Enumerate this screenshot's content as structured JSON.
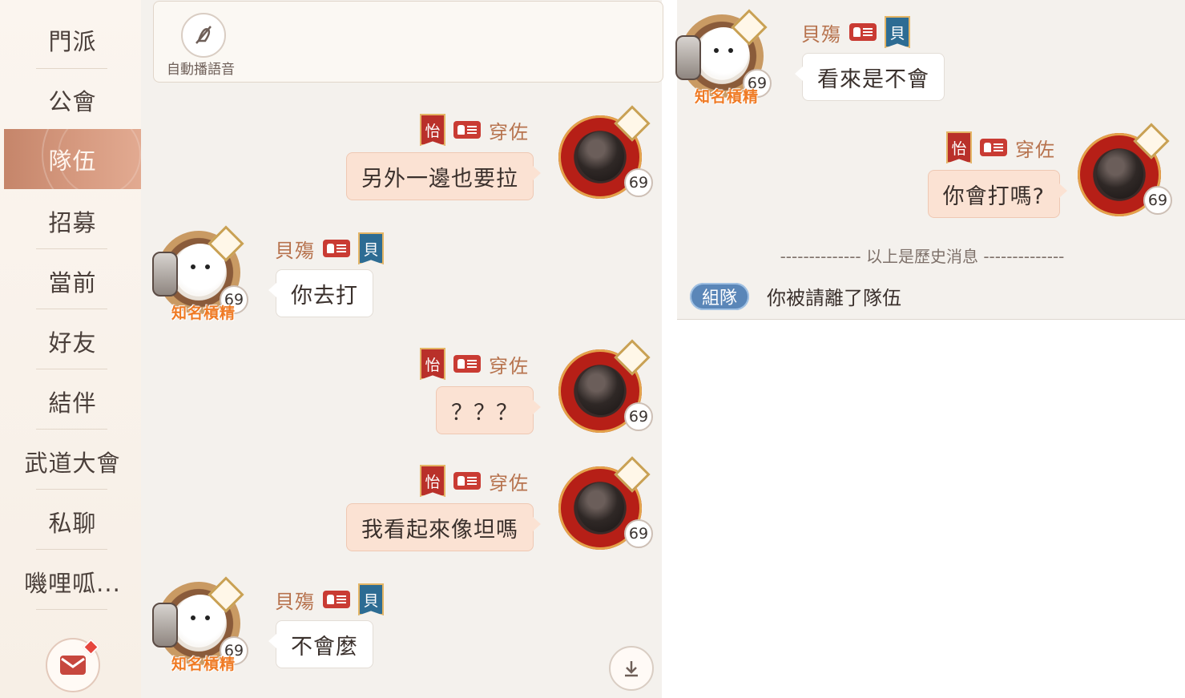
{
  "sidebar": {
    "items": [
      {
        "label": "門派"
      },
      {
        "label": "公會"
      },
      {
        "label": "隊伍",
        "active": true
      },
      {
        "label": "招募"
      },
      {
        "label": "當前"
      },
      {
        "label": "好友"
      },
      {
        "label": "結伴"
      },
      {
        "label": "武道大會"
      },
      {
        "label": "私聊"
      },
      {
        "label": "嘰哩呱..."
      }
    ],
    "mail_icon": "mail-icon"
  },
  "toolbar": {
    "auto_voice_label": "自動播語音"
  },
  "users": {
    "me": {
      "name": "穿佐",
      "tag": "怡",
      "level": "69"
    },
    "other": {
      "name": "貝殤",
      "tag": "貝",
      "level": "69",
      "title": "知名槓精"
    }
  },
  "messages_left": [
    {
      "from": "me",
      "text": "另外一邊也要拉"
    },
    {
      "from": "other",
      "text": "你去打"
    },
    {
      "from": "me",
      "text": "？？？"
    },
    {
      "from": "me",
      "text": "我看起來像坦嗎"
    },
    {
      "from": "other",
      "text": "不會麼"
    }
  ],
  "messages_right": [
    {
      "from": "other",
      "text": "看來是不會"
    },
    {
      "from": "me",
      "text": "你會打嗎?"
    }
  ],
  "history_separator": "-------------- 以上是歷史消息 --------------",
  "system_message": {
    "badge": "組隊",
    "text": "你被請離了隊伍"
  },
  "colors": {
    "accent": "#d49a80",
    "my_bubble": "#fbe2d3",
    "name": "#b7734e",
    "badge_blue": "#5a86b8"
  }
}
